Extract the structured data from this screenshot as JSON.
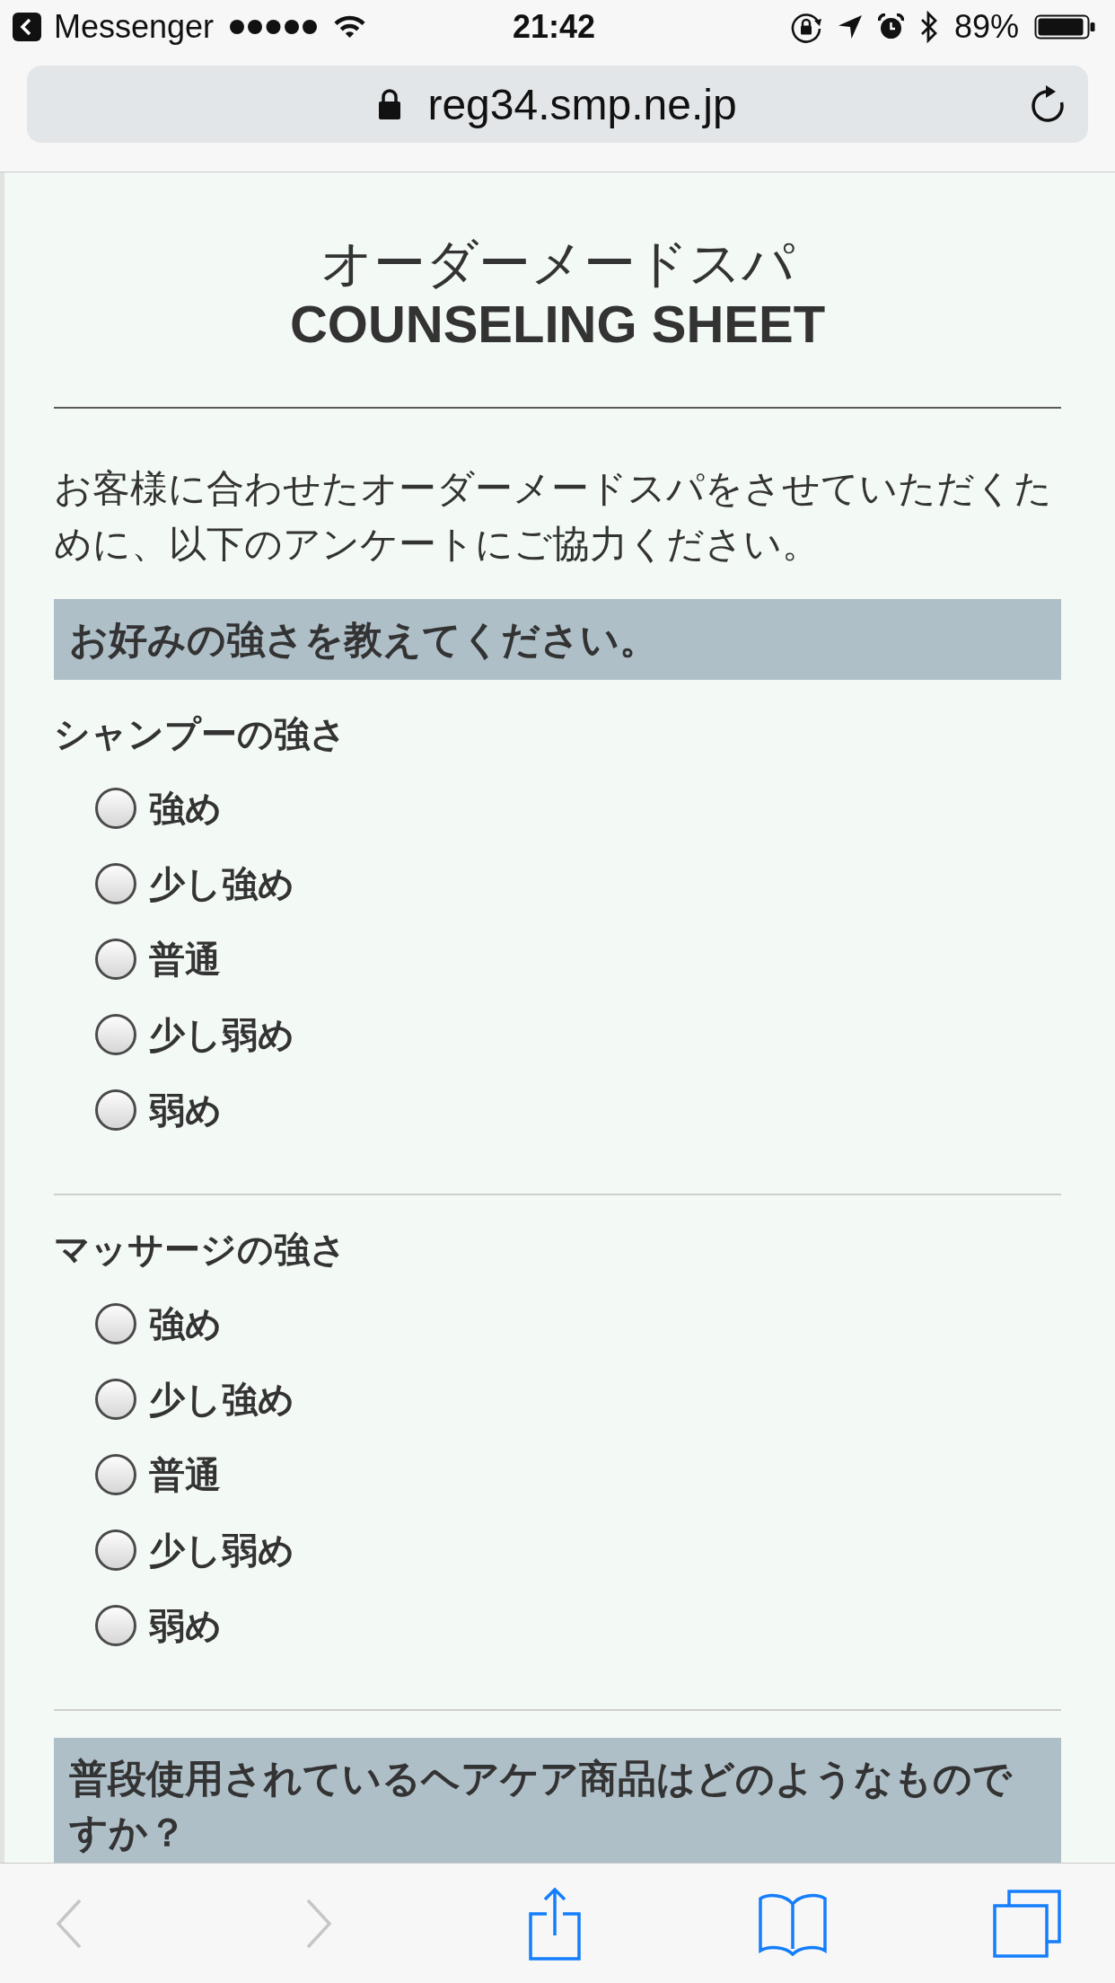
{
  "status_bar": {
    "back_app": "Messenger",
    "time": "21:42",
    "battery": "89%"
  },
  "address_bar": {
    "url": "reg34.smp.ne.jp"
  },
  "page": {
    "title": "オーダーメードスパ",
    "subtitle": "COUNSELING SHEET",
    "intro": "お客様に合わせたオーダーメードスパをさせていただくために、以下のアンケートにご協力ください。",
    "sections": [
      {
        "heading": "お好みの強さを教えてください。",
        "questions": [
          {
            "label": "シャンプーの強さ",
            "options": [
              {
                "label": "強め",
                "selected": false
              },
              {
                "label": "少し強め",
                "selected": false
              },
              {
                "label": "普通",
                "selected": false
              },
              {
                "label": "少し弱め",
                "selected": false
              },
              {
                "label": "弱め",
                "selected": false
              }
            ]
          },
          {
            "label": "マッサージの強さ",
            "options": [
              {
                "label": "強め",
                "selected": false
              },
              {
                "label": "少し強め",
                "selected": false
              },
              {
                "label": "普通",
                "selected": false
              },
              {
                "label": "少し弱め",
                "selected": false
              },
              {
                "label": "弱め",
                "selected": false
              }
            ]
          }
        ]
      },
      {
        "heading": "普段使用されているヘアケア商品はどのようなものですか？"
      }
    ]
  },
  "toolbar": {
    "buttons": [
      {
        "kind": "back",
        "disabled": true
      },
      {
        "kind": "forward",
        "disabled": true
      },
      {
        "kind": "share",
        "disabled": false
      },
      {
        "kind": "bookmarks",
        "disabled": false
      },
      {
        "kind": "tabs",
        "disabled": false
      }
    ]
  }
}
